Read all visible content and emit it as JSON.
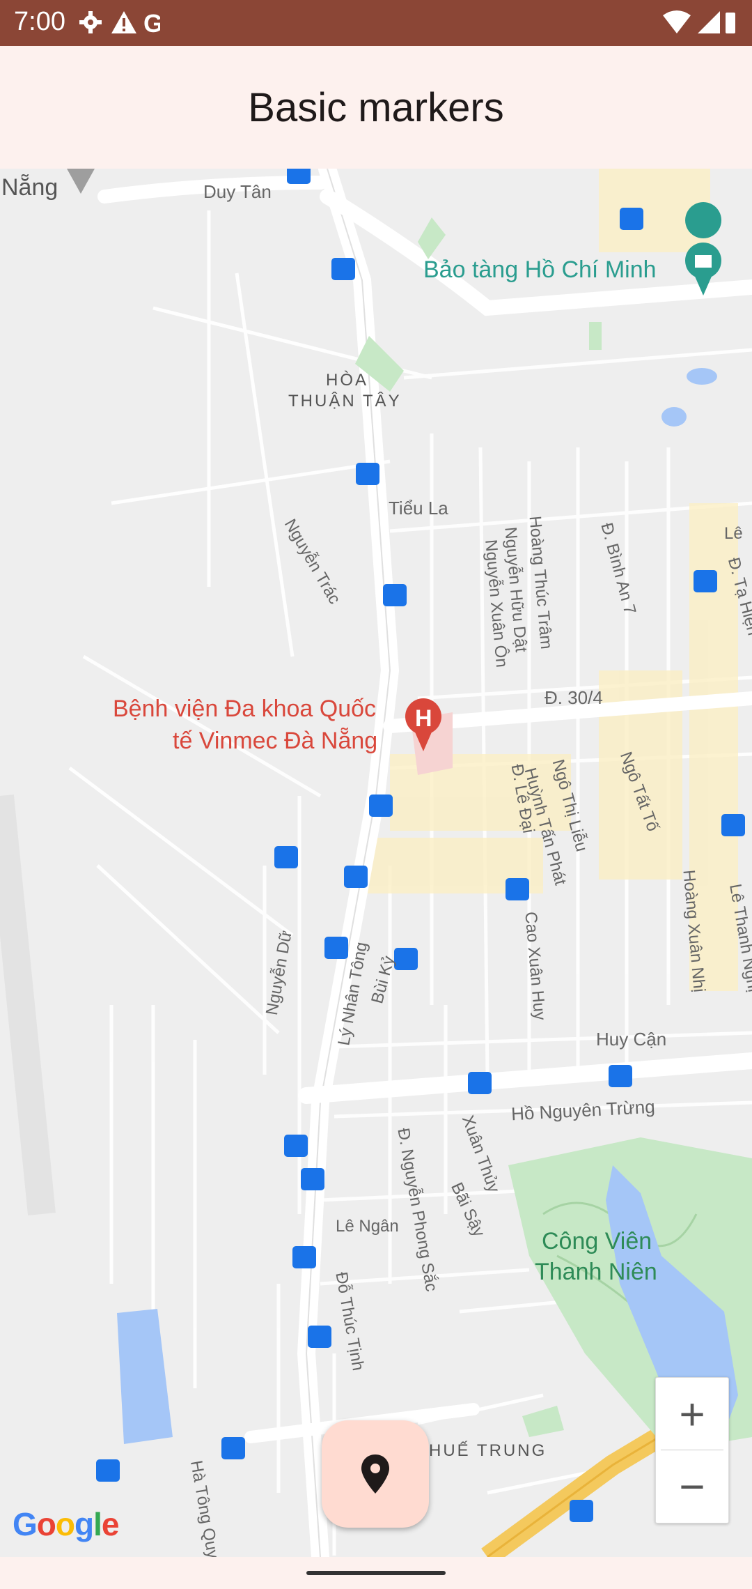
{
  "status_bar": {
    "time": "7:00"
  },
  "app_bar": {
    "title": "Basic markers"
  },
  "map": {
    "labels": {
      "da_nang": "Nẵng",
      "duy_tan": "Duy Tân",
      "museum": "Bảo tàng Hồ Chí Minh",
      "hoa": "HÒA",
      "thuan_tay": "THUẬN TÂY",
      "tieu_la": "Tiểu La",
      "nguyen_trac": "Nguyễn Trác",
      "hoang_thuc_tram": "Hoàng Thúc Trâm",
      "nguyen_huu_dat": "Nguyễn Hữu Dật",
      "nguyen_xuan_on": "Nguyễn Xuân Ôn",
      "dinh_an_7": "Đ. Bình An 7",
      "ta_hien": "Đ. Tạ Hiện",
      "le": "Lê",
      "hospital_line1": "Bệnh viện Đa khoa Quốc",
      "hospital_line2": "tế Vinmec Đà Nẵng",
      "d_30_4": "Đ. 30/4",
      "ngo_thi_lieu": "Ngô Thị Liễu",
      "huynh_tan_phat": "Huỳnh Tấn Phát",
      "le_dai": "Đ. Lê Đại",
      "ngo_tat_to": "Ngô Tất Tố",
      "hoang_xuan_nhi": "Hoàng Xuân Nhị",
      "le_thanh_nghi": "Lê Thanh Nghị",
      "nguyen_du": "Nguyễn Dữ",
      "ly_nhan_tong": "Lý Nhân Tông",
      "bui_ky": "Bùi Kỷ",
      "cao_xuan_huy": "Cao Xuân Huy",
      "huy_can": "Huy Cận",
      "ho_nguyen_trung": "Hồ Nguyên Trừng",
      "nguyen_phong_sac": "Đ. Nguyễn Phong Sắc",
      "xuan_thuy": "Xuân Thủy",
      "bai_say": "Bãi Sậy",
      "le_ngan": "Lê Ngân",
      "park_line1": "Công Viên",
      "park_line2": "Thanh Niên",
      "do_thuc_tinh": "Đỗ Thúc Tịnh",
      "hue_trung": "HUẾ TRUNG",
      "ha_tong_quy": "Hà Tông Quy"
    },
    "colors": {
      "road": "#ffffff",
      "land": "#eeeeee",
      "park": "#c7e8c6",
      "water": "#a5c6f7",
      "highway": "#f4c95d",
      "poi_text": "#2a9d8f",
      "hospital_text": "#d9473b",
      "bus": "#1a73e8"
    }
  },
  "zoom": {
    "in_label": "+",
    "out_label": "−"
  },
  "google_logo": [
    "G",
    "o",
    "o",
    "g",
    "l",
    "e"
  ],
  "fab": {
    "icon": "place-icon"
  }
}
